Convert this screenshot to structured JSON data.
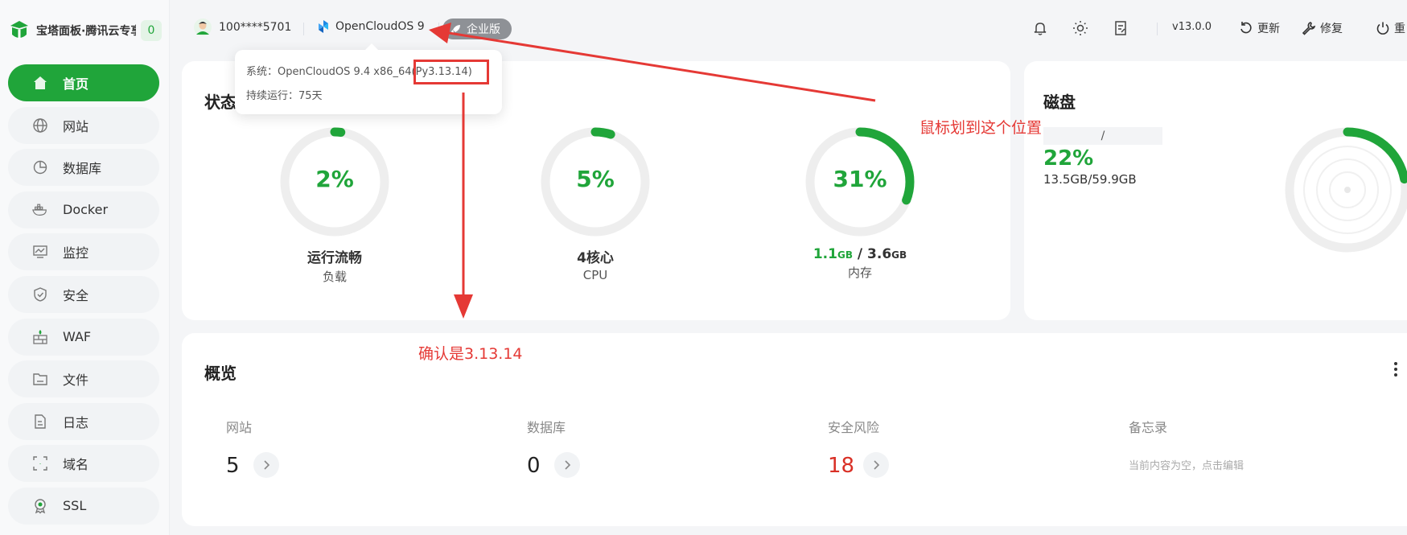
{
  "brand": {
    "title": "宝塔面板·腾讯云专享版",
    "count": "0"
  },
  "nav": [
    {
      "label": "首页",
      "icon": "home-icon"
    },
    {
      "label": "网站",
      "icon": "globe-icon"
    },
    {
      "label": "数据库",
      "icon": "database-icon"
    },
    {
      "label": "Docker",
      "icon": "docker-icon"
    },
    {
      "label": "监控",
      "icon": "monitor-icon"
    },
    {
      "label": "安全",
      "icon": "shield-icon"
    },
    {
      "label": "WAF",
      "icon": "waf-icon"
    },
    {
      "label": "文件",
      "icon": "folder-icon"
    },
    {
      "label": "日志",
      "icon": "log-icon"
    },
    {
      "label": "域名",
      "icon": "domain-icon"
    },
    {
      "label": "SSL",
      "icon": "ssl-icon"
    }
  ],
  "topbar": {
    "user": "100****5701",
    "os": "OpenCloudOS 9",
    "edition": "企业版",
    "version": "v13.0.0",
    "update_label": "更新",
    "repair_label": "修复",
    "restart_label": "重"
  },
  "tooltip": {
    "system_line": "系统：OpenCloudOS 9.4 x86_64(Py3.13.14)",
    "uptime_line": "持续运行：75天"
  },
  "status": {
    "title": "状态",
    "gauges": [
      {
        "percent": "2%",
        "label": "运行流畅",
        "sub": "负载",
        "value": 0.02
      },
      {
        "percent": "5%",
        "label": "4核心",
        "sub": "CPU",
        "value": 0.05
      },
      {
        "percent": "31%",
        "used": "1.1",
        "used_unit": "GB",
        "sep": "/",
        "total": "3.6",
        "total_unit": "GB",
        "sub": "内存",
        "value": 0.31
      }
    ]
  },
  "disk": {
    "title": "磁盘",
    "path": "/",
    "percent": "22%",
    "usage": "13.5GB/59.9GB",
    "value": 0.22
  },
  "overview": {
    "title": "概览",
    "items": [
      {
        "label": "网站",
        "value": "5"
      },
      {
        "label": "数据库",
        "value": "0"
      },
      {
        "label": "安全风险",
        "value": "18"
      },
      {
        "label": "备忘录",
        "placeholder": "当前内容为空，点击编辑"
      }
    ]
  },
  "annotations": {
    "hover": "鼠标划到这个位置",
    "confirm": "确认是3.13.14"
  },
  "colors": {
    "accent": "#20a53a",
    "danger": "#e53935",
    "risk": "#d93026"
  }
}
